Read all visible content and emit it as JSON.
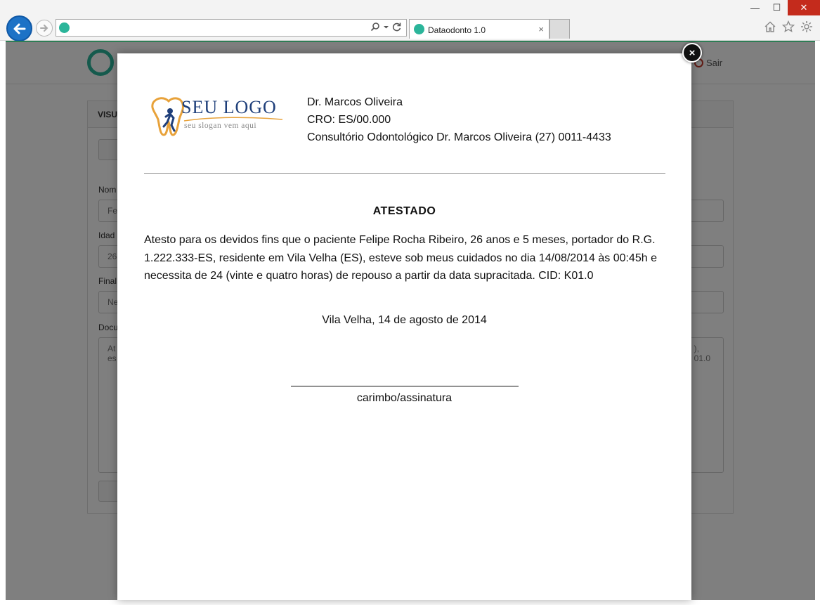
{
  "browser": {
    "tab_title": "Dataodonto 1.0",
    "address_url": "",
    "window_controls": {
      "minimize": "—",
      "maximize": "☐",
      "close": "✕"
    },
    "tab_close": "×",
    "icons": [
      "back-arrow-icon",
      "forward-arrow-icon",
      "search-icon",
      "refresh-icon",
      "home-icon",
      "star-icon",
      "gear-icon"
    ]
  },
  "app": {
    "logout_label": "Sair",
    "panel_title": "VISU",
    "fields": [
      {
        "label": "Nom",
        "value": "Fe"
      },
      {
        "label": "Idad",
        "value": "26"
      },
      {
        "label": "Final",
        "value": "Ne"
      },
      {
        "label": "Docu",
        "value": "At\nes"
      }
    ],
    "textarea_right_fragment": "),\n01.0"
  },
  "document": {
    "logo_text": "SEU LOGO",
    "logo_slogan": "seu slogan vem aqui",
    "dentist_name": "Dr. Marcos Oliveira",
    "cro": "CRO: ES/00.000",
    "clinic": "Consultório Odontológico Dr. Marcos Oliveira (27) 0011-4433",
    "title": "ATESTADO",
    "body": "Atesto para os devidos fins que o paciente Felipe Rocha Ribeiro, 26 anos e 5 meses, portador do R.G. 1.222.333-ES, residente em Vila Velha (ES), esteve sob meus cuidados no dia 14/08/2014 às 00:45h e necessita de 24 (vinte e quatro horas) de repouso a partir da data supracitada. CID: K01.0",
    "date_line": "Vila Velha, 14 de agosto de 2014",
    "signature_label": "carimbo/assinatura",
    "close_glyph": "×"
  },
  "colors": {
    "accent": "#2bb59a",
    "browser_back": "#1d72c6",
    "logo_blue": "#1f3f7a",
    "logo_orange": "#e8a23a",
    "overlay": "rgba(0,0,0,0.5)"
  }
}
